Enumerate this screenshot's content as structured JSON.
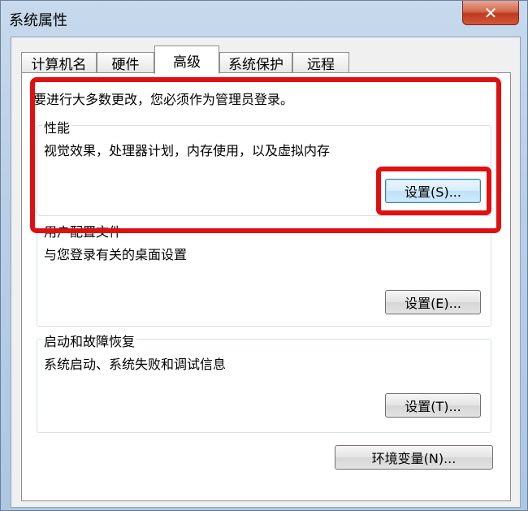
{
  "window": {
    "title": "系统属性",
    "close_glyph": "✕"
  },
  "tabs": [
    {
      "label": "计算机名",
      "active": false
    },
    {
      "label": "硬件",
      "active": false
    },
    {
      "label": "高级",
      "active": true
    },
    {
      "label": "系统保护",
      "active": false
    },
    {
      "label": "远程",
      "active": false
    }
  ],
  "advanced": {
    "admin_note": "要进行大多数更改，您必须作为管理员登录。",
    "performance": {
      "title": "性能",
      "description": "视觉效果，处理器计划，内存使用，以及虚拟内存",
      "button": "设置(S)..."
    },
    "user_profiles": {
      "title": "用户配置文件",
      "description": "与您登录有关的桌面设置",
      "button": "设置(E)..."
    },
    "startup_recovery": {
      "title": "启动和故障恢复",
      "description": "系统启动、系统失败和调试信息",
      "button": "设置(T)..."
    },
    "env_button": "环境变量(N)..."
  },
  "colors": {
    "highlight": "#e01010",
    "close_button": "#c0391d"
  }
}
